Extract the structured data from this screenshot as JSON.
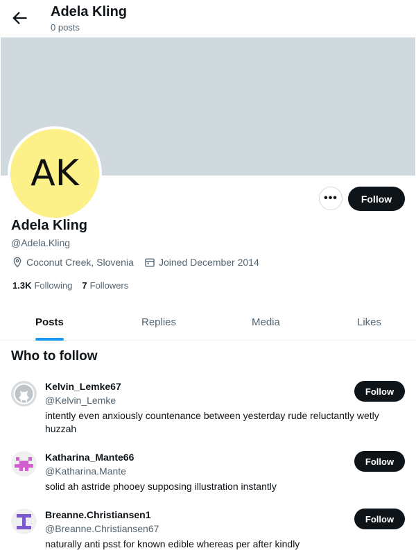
{
  "header": {
    "title": "Adela Kling",
    "posts_count": "0 posts"
  },
  "profile": {
    "avatar_initials": "AK",
    "avatar_color": "#fcf088",
    "banner_color": "#cfd9de",
    "name": "Adela Kling",
    "handle": "@Adela.Kling",
    "location": "Coconut Creek, Slovenia",
    "joined": "Joined December 2014",
    "following_count": "1.3K",
    "following_label": "Following",
    "followers_count": "7",
    "followers_label": "Followers",
    "more_label": "•••",
    "follow_label": "Follow"
  },
  "tabs": [
    {
      "label": "Posts",
      "active": true
    },
    {
      "label": "Replies"
    },
    {
      "label": "Media"
    },
    {
      "label": "Likes"
    }
  ],
  "who_to_follow": {
    "title": "Who to follow",
    "users": [
      {
        "name": "Kelvin_Lemke67",
        "handle": "@Kelvin_Lemke",
        "bio": "intently even anxiously countenance between yesterday rude reluctantly wetly huzzah",
        "follow_label": "Follow",
        "avatar_icon": "github-octocat-icon"
      },
      {
        "name": "Katharina_Mante66",
        "handle": "@Katharina.Mante",
        "bio": "solid ah astride phooey supposing illustration instantly",
        "follow_label": "Follow",
        "avatar_icon": "identicon-pink-icon"
      },
      {
        "name": "Breanne.Christiansen1",
        "handle": "@Breanne.Christiansen67",
        "bio": "naturally anti psst for known edible whereas per after kindly",
        "follow_label": "Follow",
        "avatar_icon": "identicon-purple-icon"
      }
    ]
  },
  "accent_color": "#1d9bf0"
}
